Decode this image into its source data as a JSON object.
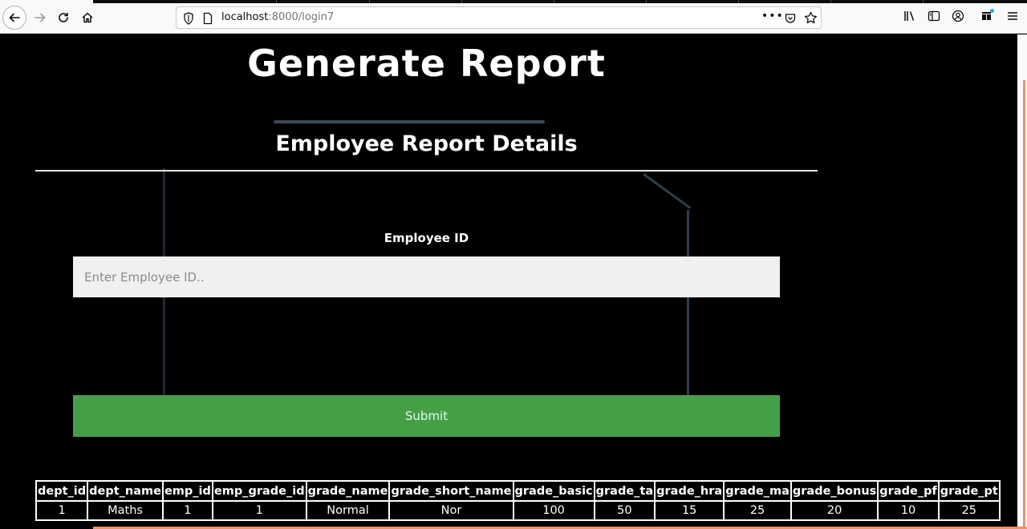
{
  "browser": {
    "url_host": "localhost",
    "url_rest": ":8000/login7",
    "overflow_menu": "•••"
  },
  "page": {
    "title": "Generate Report",
    "subtitle": "Employee Report Details",
    "field_label": "Employee ID",
    "input_placeholder": "Enter Employee ID..",
    "input_value": "",
    "submit_label": "Submit"
  },
  "table": {
    "headers": [
      "dept_id",
      "dept_name",
      "emp_id",
      "emp_grade_id",
      "grade_name",
      "grade_short_name",
      "grade_basic",
      "grade_ta",
      "grade_hra",
      "grade_ma",
      "grade_bonus",
      "grade_pf",
      "grade_pt"
    ],
    "rows": [
      [
        "1",
        "Maths",
        "1",
        "1",
        "Normal",
        "Nor",
        "100",
        "50",
        "15",
        "25",
        "20",
        "10",
        "25"
      ]
    ]
  },
  "colors": {
    "page_background": "#000000",
    "submit_background": "#43a047",
    "accent_orange": "#e9946b"
  }
}
